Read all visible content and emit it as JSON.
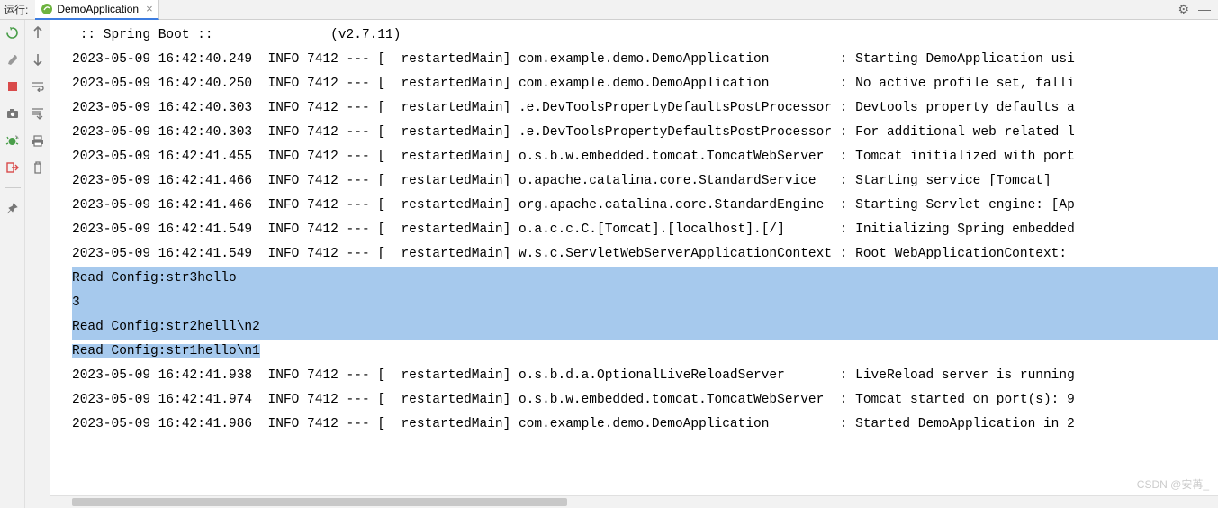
{
  "top": {
    "run_label": "运行:",
    "tab_name": "DemoApplication",
    "gear": "⚙",
    "minimize": "—"
  },
  "gutter1": {
    "rerun": "↻",
    "stop": "■",
    "camera": "📷",
    "bug": "🐞",
    "exit": "🚪",
    "pin": "📌"
  },
  "gutter2": {
    "up": "↑",
    "down": "↓",
    "wrap": "⇆",
    "scroll": "↧",
    "print": "🖶",
    "trash": "🗑"
  },
  "lines": [
    " :: Spring Boot ::               (v2.7.11)",
    "",
    "2023-05-09 16:42:40.249  INFO 7412 --- [  restartedMain] com.example.demo.DemoApplication         : Starting DemoApplication usi",
    "2023-05-09 16:42:40.250  INFO 7412 --- [  restartedMain] com.example.demo.DemoApplication         : No active profile set, falli",
    "2023-05-09 16:42:40.303  INFO 7412 --- [  restartedMain] .e.DevToolsPropertyDefaultsPostProcessor : Devtools property defaults a",
    "2023-05-09 16:42:40.303  INFO 7412 --- [  restartedMain] .e.DevToolsPropertyDefaultsPostProcessor : For additional web related l",
    "2023-05-09 16:42:41.455  INFO 7412 --- [  restartedMain] o.s.b.w.embedded.tomcat.TomcatWebServer  : Tomcat initialized with port",
    "2023-05-09 16:42:41.466  INFO 7412 --- [  restartedMain] o.apache.catalina.core.StandardService   : Starting service [Tomcat]",
    "2023-05-09 16:42:41.466  INFO 7412 --- [  restartedMain] org.apache.catalina.core.StandardEngine  : Starting Servlet engine: [Ap",
    "2023-05-09 16:42:41.549  INFO 7412 --- [  restartedMain] o.a.c.c.C.[Tomcat].[localhost].[/]       : Initializing Spring embedded",
    "2023-05-09 16:42:41.549  INFO 7412 --- [  restartedMain] w.s.c.ServletWebServerApplicationContext : Root WebApplicationContext: ",
    "Read Config:str3hello",
    "3",
    "Read Config:str2helll\\n2",
    "Read Config:str1hello\\n1",
    "2023-05-09 16:42:41.938  INFO 7412 --- [  restartedMain] o.s.b.d.a.OptionalLiveReloadServer       : LiveReload server is running",
    "2023-05-09 16:42:41.974  INFO 7412 --- [  restartedMain] o.s.b.w.embedded.tomcat.TomcatWebServer  : Tomcat started on port(s): 9",
    "2023-05-09 16:42:41.986  INFO 7412 --- [  restartedMain] com.example.demo.DemoApplication         : Started DemoApplication in 2"
  ],
  "selection": {
    "full": [
      11,
      12,
      13
    ],
    "partial": 14
  },
  "watermark": "CSDN @安苒_"
}
